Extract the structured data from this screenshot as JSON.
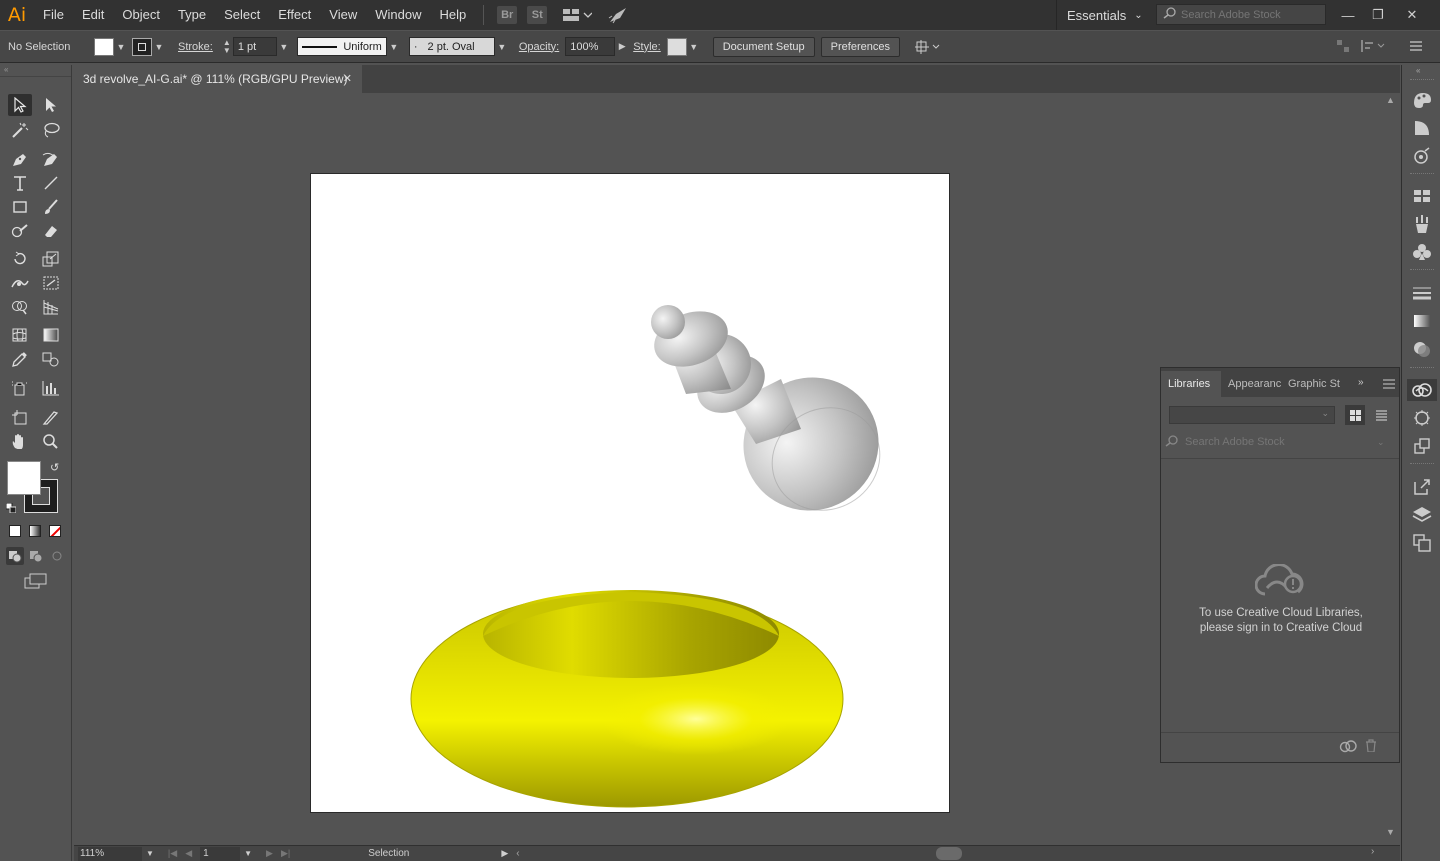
{
  "app": {
    "logo": "Ai"
  },
  "menu": [
    "File",
    "Edit",
    "Object",
    "Type",
    "Select",
    "Effect",
    "View",
    "Window",
    "Help"
  ],
  "menubar_icons": {
    "bridge": "Br",
    "stock": "St"
  },
  "workspace": {
    "label": "Essentials"
  },
  "stock_search": {
    "placeholder": "Search Adobe Stock"
  },
  "control": {
    "selection": "No Selection",
    "stroke_label": "Stroke:",
    "stroke_weight": "1 pt",
    "profile": "Uniform",
    "brush": "2 pt. Oval",
    "opacity_label": "Opacity:",
    "opacity": "100%",
    "style_label": "Style:",
    "document_setup": "Document Setup",
    "preferences": "Preferences"
  },
  "document": {
    "tab_title": "3d revolve_AI-G.ai* @ 111% (RGB/GPU Preview)"
  },
  "status": {
    "zoom": "111%",
    "artboard": "1",
    "tool": "Selection"
  },
  "libraries": {
    "tabs": [
      "Libraries",
      "Appearanc",
      "Graphic St"
    ],
    "search_placeholder": "Search Adobe Stock",
    "message_line1": "To use Creative Cloud Libraries,",
    "message_line2": "please sign in to Creative Cloud"
  },
  "colors": {
    "accent": "#ff9a00",
    "torus_yellow": "#d4d000",
    "pawn_gray": "#c0c0c0"
  }
}
